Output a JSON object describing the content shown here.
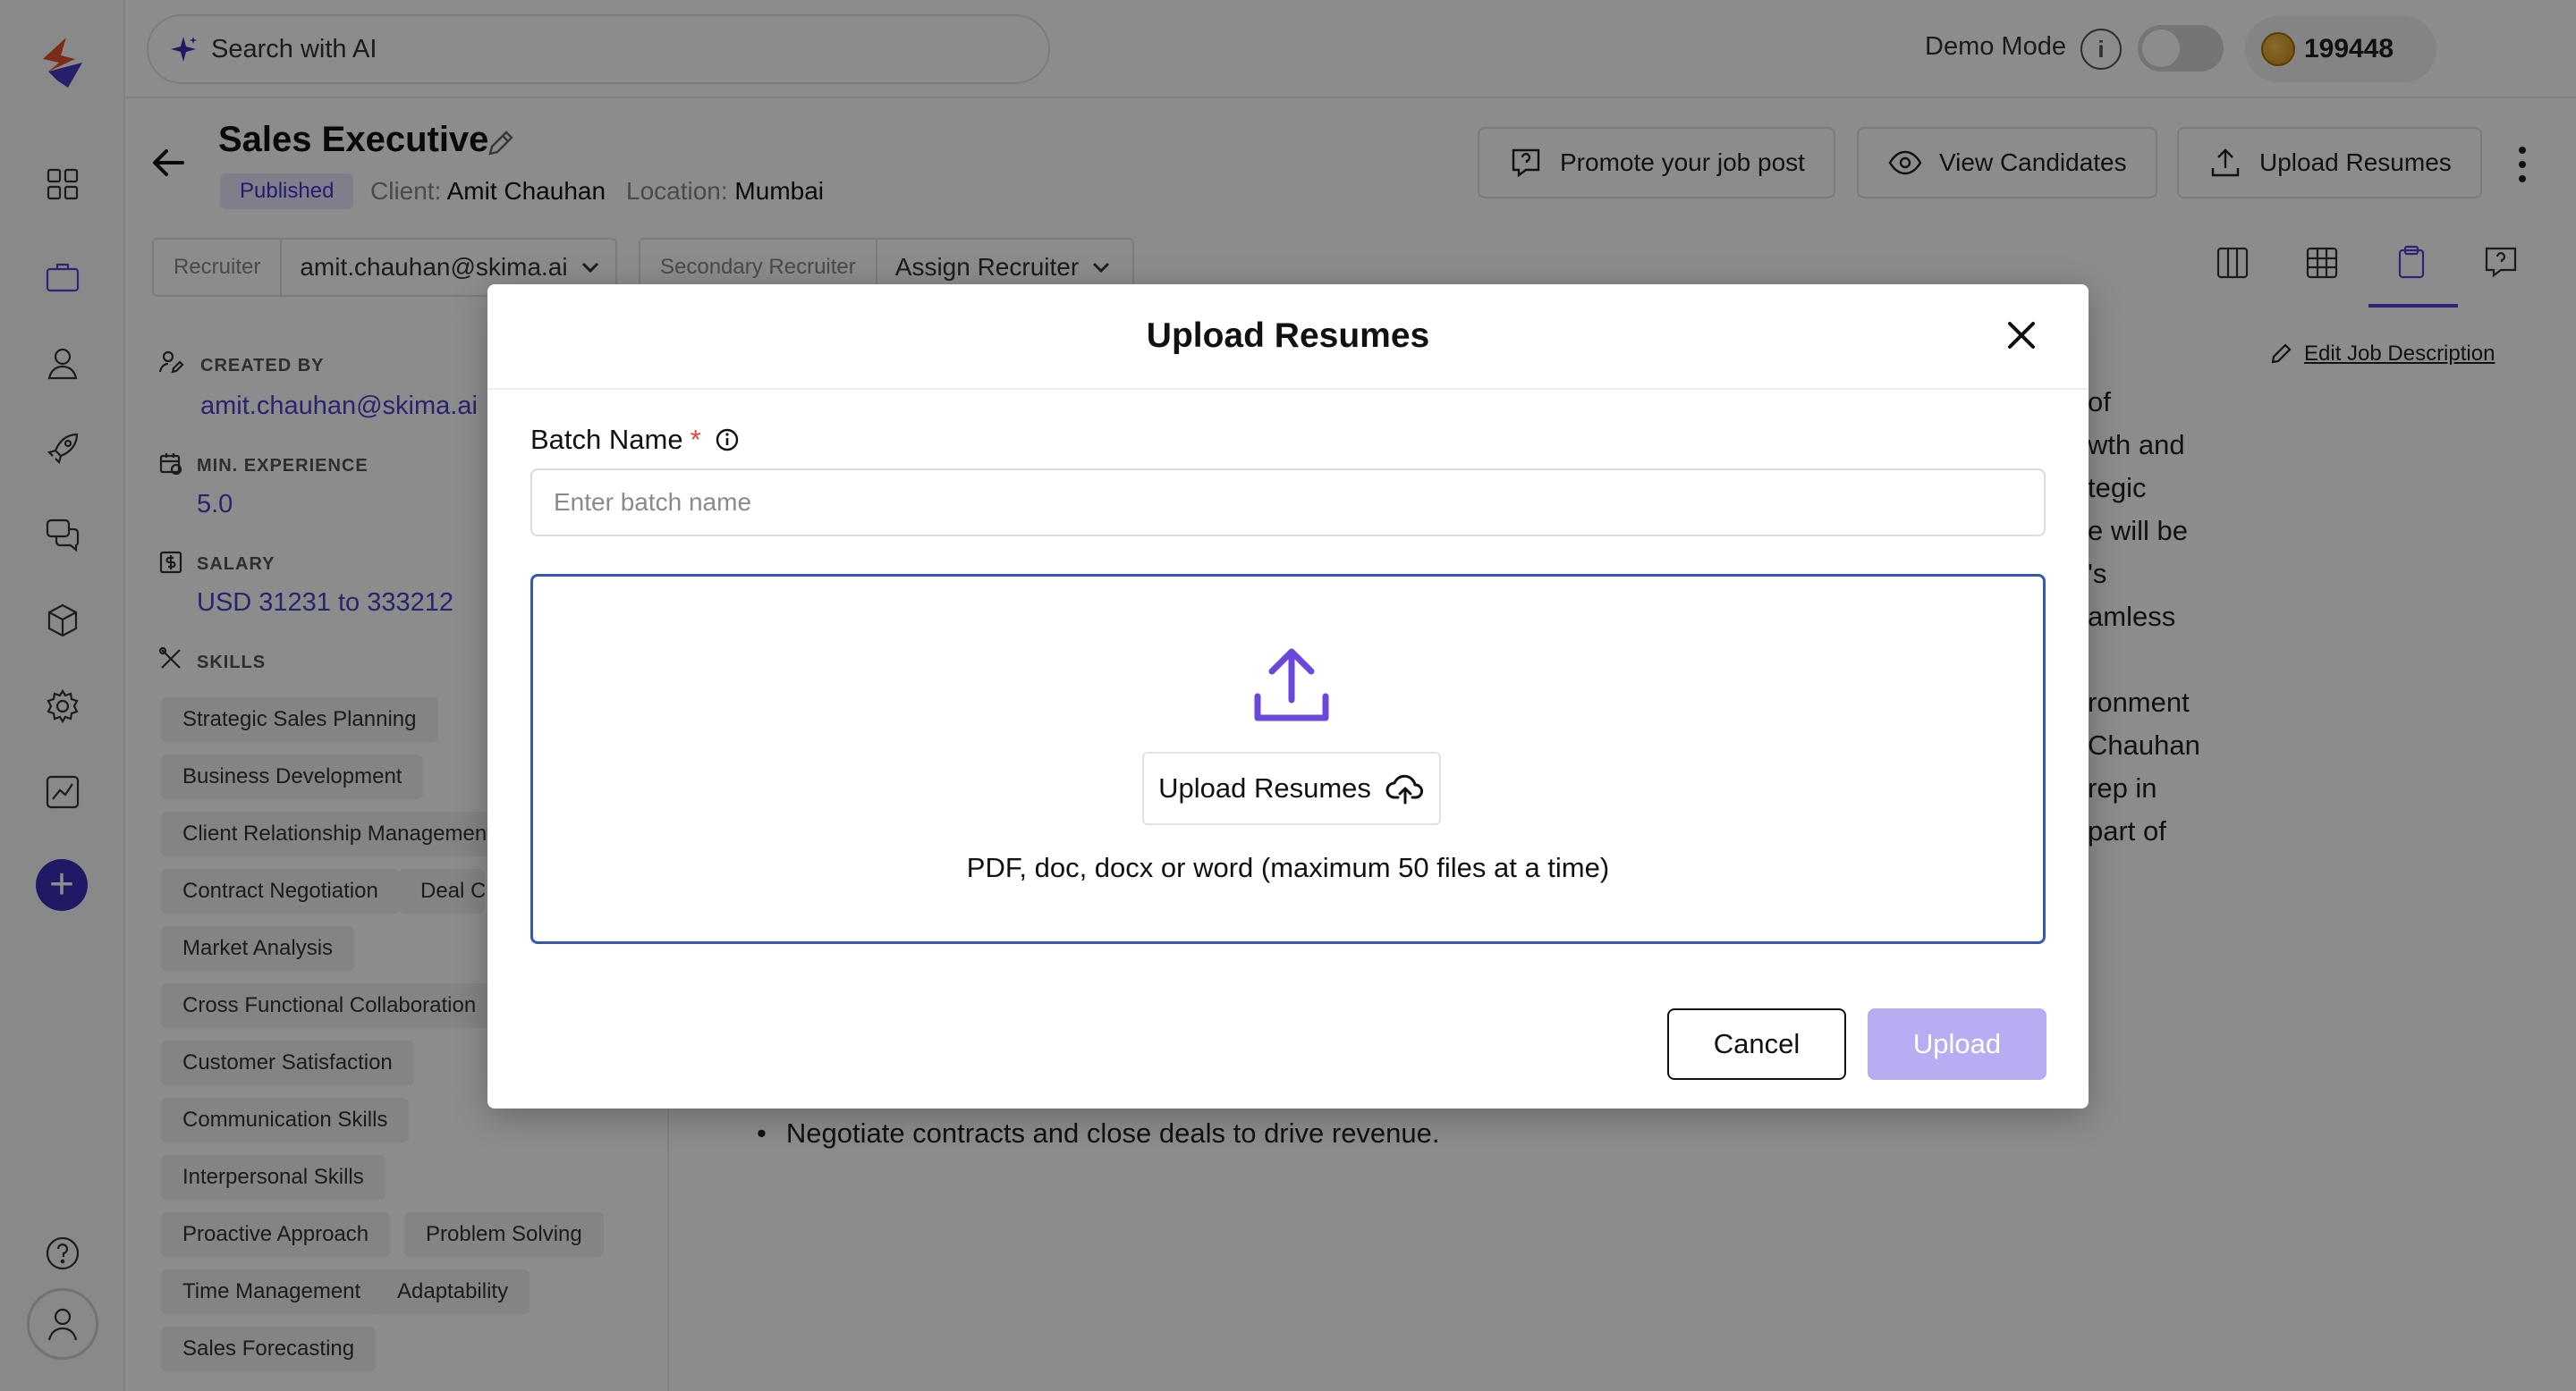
{
  "search": {
    "label": "Search with AI"
  },
  "topbar": {
    "demo_mode_label": "Demo Mode",
    "credits": "199448"
  },
  "job": {
    "title": "Sales Executive",
    "status": "Published",
    "client_label": "Client:",
    "client_value": "Amit Chauhan",
    "location_label": "Location:",
    "location_value": "Mumbai"
  },
  "header_buttons": {
    "promote": "Promote your job post",
    "view_candidates": "View Candidates",
    "upload_resumes": "Upload Resumes"
  },
  "recruiters": {
    "recruiter_label": "Recruiter",
    "recruiter_value": "amit.chauhan@skima.ai",
    "secondary_label": "Secondary Recruiter",
    "secondary_value": "Assign Recruiter"
  },
  "details": {
    "created_by_label": "CREATED BY",
    "created_by_value": "amit.chauhan@skima.ai",
    "min_exp_label": "MIN. EXPERIENCE",
    "min_exp_value": "5.0",
    "salary_label": "SALARY",
    "salary_value": "USD 31231 to 333212",
    "skills_label": "SKILLS",
    "skills": [
      "Strategic Sales Planning",
      "Business Development",
      "Client Relationship Management",
      "Contract Negotiation",
      "Deal C",
      "Market Analysis",
      "Cross Functional Collaboration",
      "Customer Satisfaction",
      "Communication Skills",
      "Interpersonal Skills",
      "Proactive Approach",
      "Problem Solving",
      "Time Management",
      "Adaptability",
      "Sales Forecasting"
    ]
  },
  "description": {
    "edit_label": "Edit Job Description",
    "fragments": [
      "of",
      "wth and",
      "tegic",
      "e will be",
      "'s",
      "amless",
      "ronment",
      "Chauhan",
      "rep in",
      "part of"
    ],
    "bullet": "Negotiate contracts and close deals to drive revenue."
  },
  "modal": {
    "title": "Upload Resumes",
    "batch_label": "Batch Name",
    "required_mark": "*",
    "batch_placeholder": "Enter batch name",
    "batch_value": "",
    "upload_button": "Upload Resumes",
    "hint": "PDF, doc, docx or word (maximum 50 files at a time)",
    "cancel": "Cancel",
    "submit": "Upload"
  }
}
